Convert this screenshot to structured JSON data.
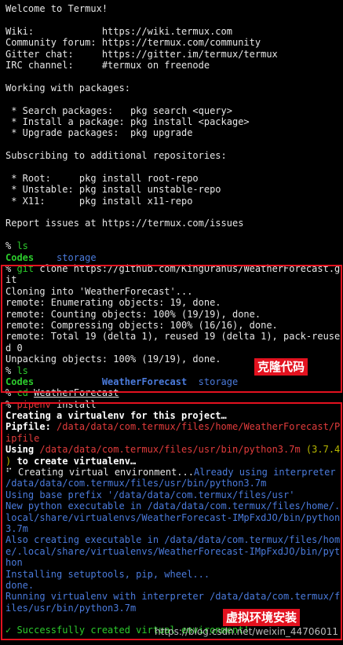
{
  "welcome": "Welcome to Termux!",
  "links": {
    "wiki": "Wiki:            https://wiki.termux.com",
    "forum": "Community forum: https://termux.com/community",
    "gitter": "Gitter chat:     https://gitter.im/termux/termux",
    "irc": "IRC channel:     #termux on freenode"
  },
  "packages": {
    "heading": "Working with packages:",
    "search": " * Search packages:   pkg search <query>",
    "install": " * Install a package: pkg install <package>",
    "upgrade": " * Upgrade packages:  pkg upgrade"
  },
  "repos": {
    "heading": "Subscribing to additional repositories:",
    "root": " * Root:     pkg install root-repo",
    "unstable": " * Unstable: pkg install unstable-repo",
    "x11": " * X11:      pkg install x11-repo"
  },
  "issues": "Report issues at https://termux.com/issues",
  "prompt": "% ",
  "ls1": {
    "cmd": "ls",
    "dir1": "Codes",
    "dir2": "storage"
  },
  "git": {
    "cmd": "git",
    "args": " clone https://github.com/KingUranus/WeatherForecast.g",
    "wrap": "it",
    "cloning": "Cloning into 'WeatherForecast'...",
    "enumerating": "remote: Enumerating objects: 19, done.",
    "counting": "remote: Counting objects: 100% (19/19), done.",
    "compressing": "remote: Compressing objects: 100% (16/16), done.",
    "total": "remote: Total 19 (delta 1), reused 19 (delta 1), pack-reuse",
    "total_wrap": "d 0",
    "unpacking": "Unpacking objects: 100% (19/19), done."
  },
  "ls2": {
    "cmd": "ls",
    "dir1": "Codes",
    "dir2": "WeatherForecast",
    "dir3": "storage"
  },
  "cd": {
    "cmd": "cd",
    "arg": "WeatherForecast"
  },
  "pipenv": {
    "cmd": "pipenv",
    "args": " install",
    "creating": "Creating a virtualenv for this project…",
    "pipfile_label": "Pipfile: ",
    "pipfile_path": "/data/data/com.termux/files/home/WeatherForecast/P",
    "pipfile_wrap": "ipfile",
    "using_label": "Using ",
    "using_path": "/data/data/com.termux/files/usr/bin/python3.7m",
    "using_version": " (3.7.4",
    "using_wrap_paren": ")",
    "using_wrap_text": " to create virtualenv…",
    "env_prefix": "⠋ Creating virtual environment...",
    "env_already": "Already using interpreter",
    "env_path": "/data/data/com.termux/files/usr/bin/python3.7m",
    "base_prefix": "Using base prefix '/data/data/com.termux/files/usr'",
    "new_python_1": "New python executable in /data/data/com.termux/files/home/.",
    "new_python_2": "local/share/virtualenvs/WeatherForecast-IMpFxdJO/bin/python",
    "new_python_3": "3.7m",
    "also_1": "Also creating executable in /data/data/com.termux/files/hom",
    "also_2": "e/.local/share/virtualenvs/WeatherForecast-IMpFxdJO/bin/pyt",
    "also_3": "hon",
    "setuptools": "Installing setuptools, pip, wheel...",
    "done": "done.",
    "running_1": "Running virtualenv with interpreter /data/data/com.termux/f",
    "running_2": "iles/usr/bin/python3.7m",
    "success": "✓ Successfully created virtual environment!"
  },
  "annotations": {
    "clone": "克隆代码",
    "venv": "虚拟环境安装"
  },
  "watermark": "https://blog.csdn.net/weixin_44706011",
  "colors": {
    "background": "#000000",
    "text": "#e6e6e6",
    "green": "#2ccb2c",
    "blue": "#4b7bdc",
    "red": "#e23c3c",
    "annotation": "#e3121f"
  }
}
